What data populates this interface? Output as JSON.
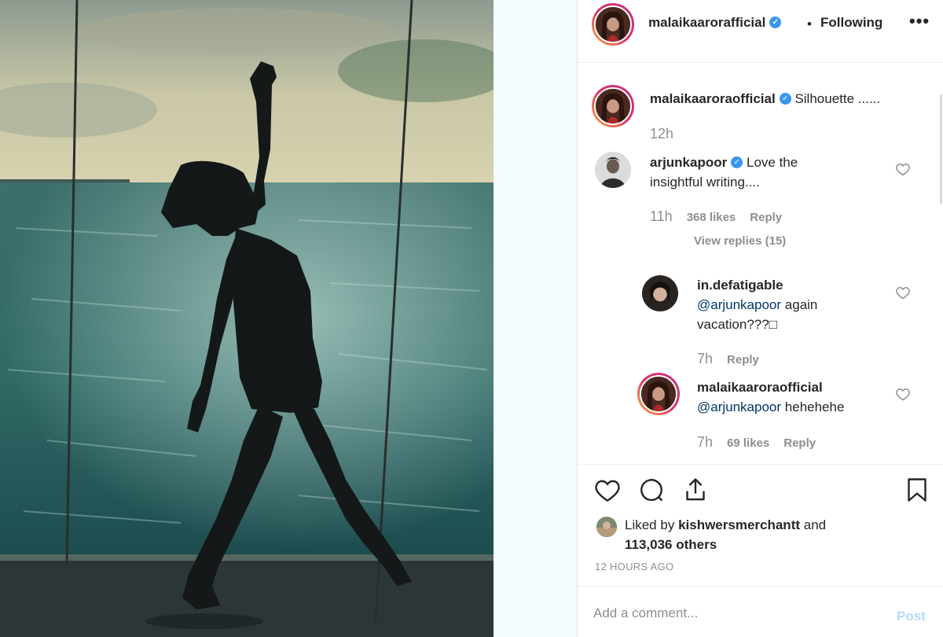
{
  "post": {
    "author": "malaikaarorafficial",
    "follow_separator": "•",
    "follow_status": "Following",
    "more_label": "•••",
    "caption_user": "malaikaaroraofficial",
    "caption_text": "Silhouette ......",
    "caption_time": "12h"
  },
  "comments": [
    {
      "user": "arjunkapoor",
      "text": "Love the insightful writing....",
      "time": "11h",
      "likes": "368 likes",
      "reply_label": "Reply",
      "view_replies": "View replies (15)"
    },
    {
      "user": "in.defatigable",
      "mention": "@arjunkapoor",
      "text": "again vacation???□",
      "time": "7h",
      "reply_label": "Reply"
    },
    {
      "user": "malaikaaroraofficial",
      "mention": "@arjunkapoor",
      "text": "hehehehe",
      "time": "7h",
      "likes": "69 likes",
      "reply_label": "Reply"
    }
  ],
  "engagement": {
    "liked_prefix": "Liked by",
    "liked_user": "kishwersmerchantt",
    "liked_and": "and",
    "liked_count": "113,036 others",
    "time_ago": "12 HOURS AGO"
  },
  "add_comment": {
    "placeholder": "Add a comment...",
    "post_label": "Post"
  },
  "icons": [
    "verified-badge-icon",
    "heart-icon",
    "comment-icon",
    "share-icon",
    "bookmark-icon",
    "more-options-icon"
  ],
  "colors": {
    "verified": "#3897f0",
    "mention": "#00376b",
    "muted": "#8e8e8e",
    "post_disabled": "#b3dbff"
  }
}
